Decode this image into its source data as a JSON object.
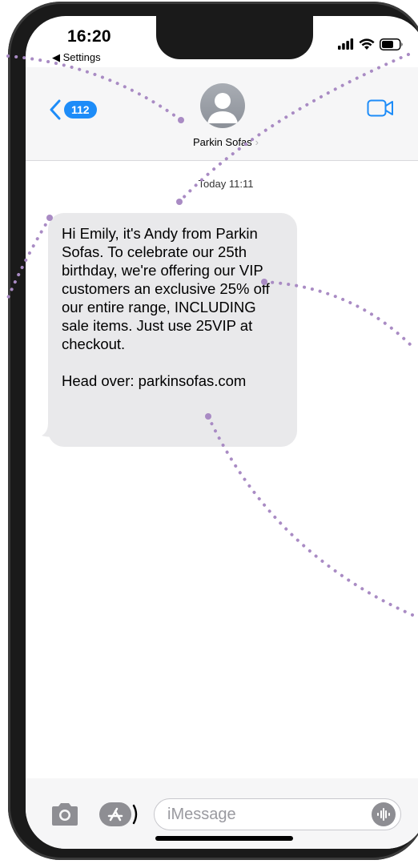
{
  "status_bar": {
    "time": "16:20",
    "back_to_app": "◀ Settings"
  },
  "header": {
    "back_badge": "112",
    "contact_name": "Parkin Sofas",
    "contact_chevron": "›"
  },
  "thread": {
    "timestamp": "Today 11:11",
    "message": {
      "paragraph_1": "Hi Emily, it's Andy from Parkin Sofas. To celebrate our 25th birthday, we're offering our VIP customers an exclusive 25% off our entire range, INCLUDING sale items. Just use 25VIP at checkout.",
      "paragraph_2": "Head over: parkinsofas.com"
    }
  },
  "input_bar": {
    "placeholder": "iMessage"
  },
  "icons": {
    "back": "chevron-left-icon",
    "video": "video-camera-icon",
    "camera": "camera-icon",
    "apps": "app-store-icon",
    "audio": "waveform-icon",
    "signal": "signal-bars-icon",
    "wifi": "wifi-icon",
    "battery": "battery-icon"
  },
  "colors": {
    "accent_blue": "#1d8cf8",
    "bubble_gray": "#e9e9eb",
    "annotation_purple": "#a98bc4"
  }
}
